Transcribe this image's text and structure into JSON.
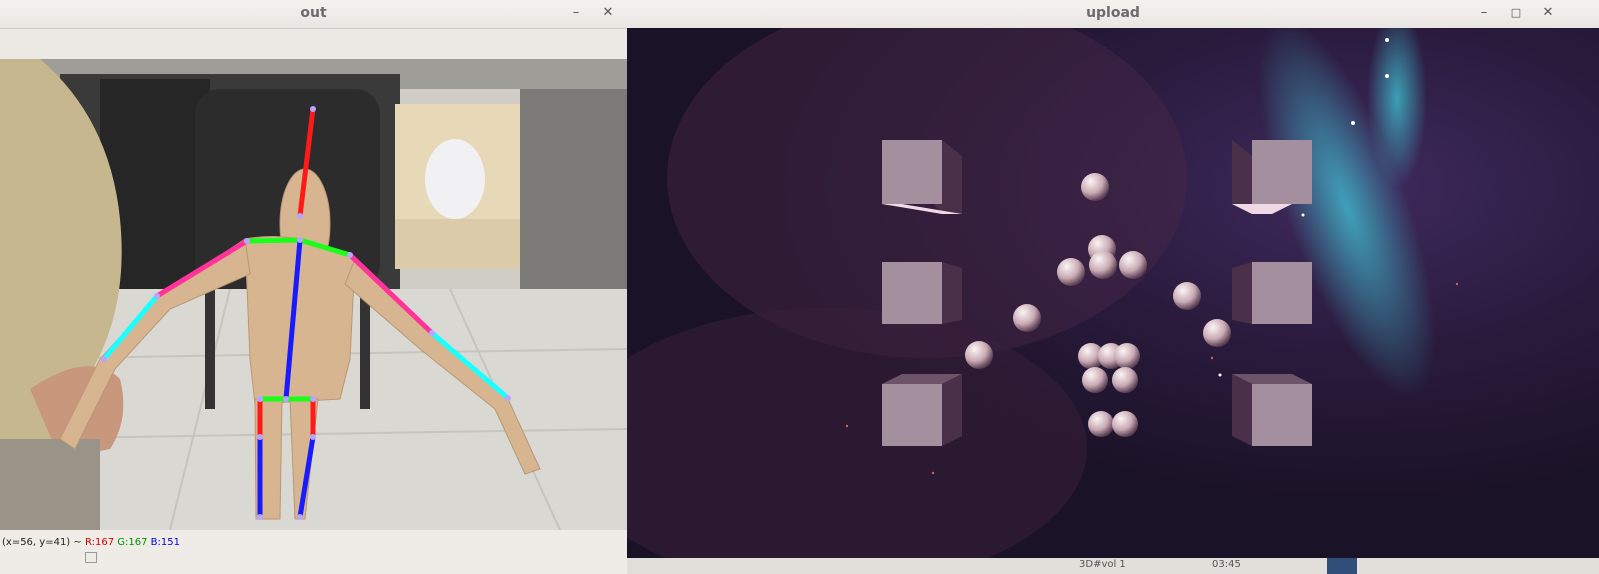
{
  "windows": {
    "out": {
      "title": "out",
      "minimize_icon": "minimize-icon",
      "close_icon": "close-icon",
      "status": {
        "coords": "(x=56, y=41) ~",
        "r": "R:167",
        "g": "G:167",
        "b": "B:151"
      }
    },
    "upload": {
      "title": "upload",
      "minimize_icon": "minimize-icon",
      "maximize_icon": "maximize-icon",
      "close_icon": "close-icon"
    }
  },
  "skeleton_colors": {
    "head": "#ff1a1a",
    "shoulders": "#1aff1a",
    "spine": "#1a1aff",
    "upper_arm": "#ff3399",
    "forearm": "#1affff"
  },
  "background_taskbar": {
    "item1": "3D#vol 1",
    "item2": "03:45"
  }
}
